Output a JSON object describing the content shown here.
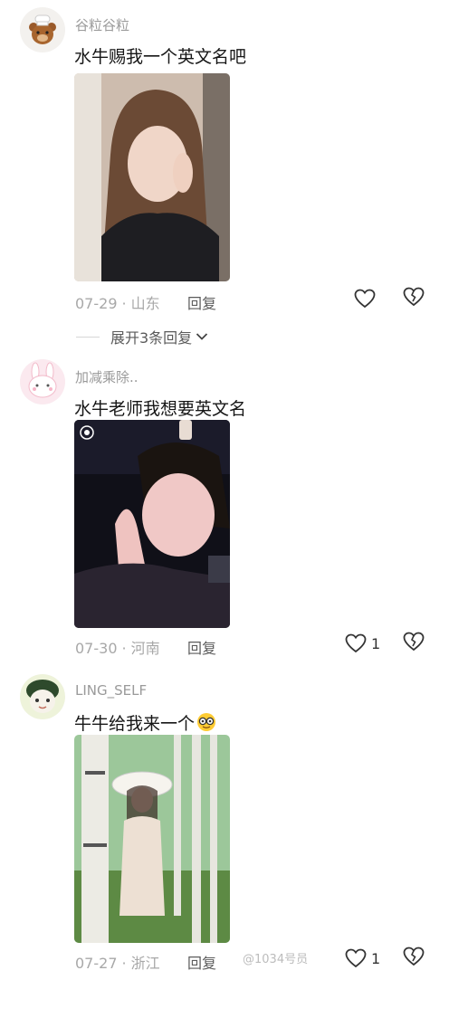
{
  "comments": [
    {
      "username": "谷粒谷粒",
      "text": "水牛赐我一个英文名吧",
      "date": "07-29",
      "location": "山东",
      "reply_label": "回复",
      "likes": "",
      "expand_label": "展开3条回复"
    },
    {
      "username": "加减乘除..",
      "text": "水牛老师我想要英文名",
      "date": "07-30",
      "location": "河南",
      "reply_label": "回复",
      "likes": "1"
    },
    {
      "username": "LING_SELF",
      "text": "牛牛给我来一个",
      "date": "07-27",
      "location": "浙江",
      "reply_label": "回复",
      "likes": "1"
    }
  ],
  "watermark": "@1034号员",
  "separator": "·"
}
